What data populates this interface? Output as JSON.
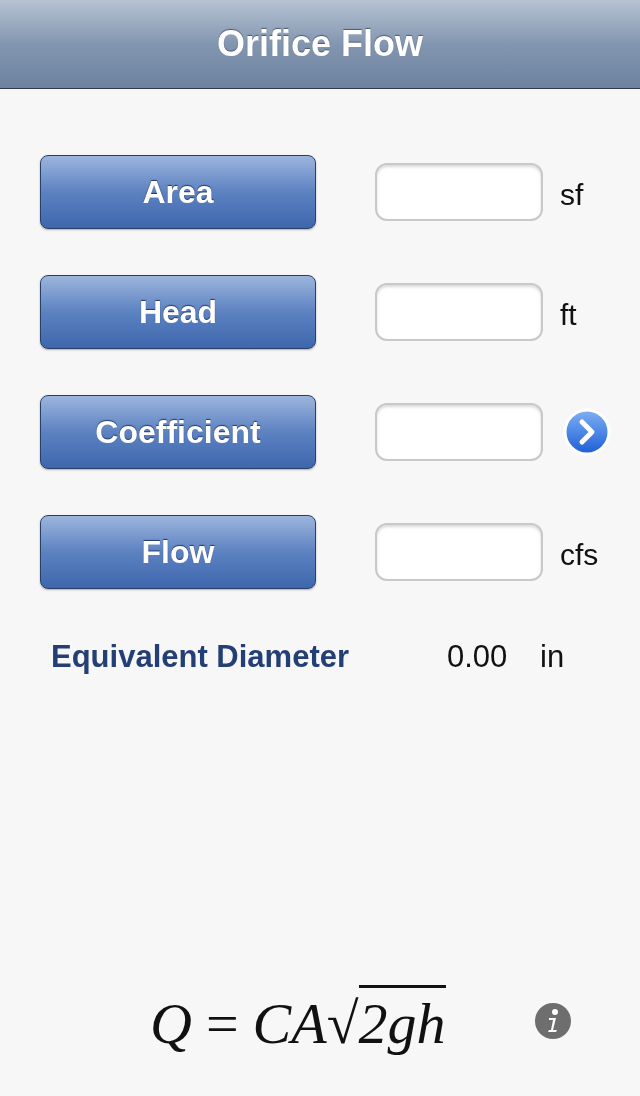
{
  "title": "Orifice Flow",
  "rows": [
    {
      "button": "Area",
      "kind": "unit",
      "unit": "sf"
    },
    {
      "button": "Head",
      "kind": "unit",
      "unit": "ft"
    },
    {
      "button": "Coefficient",
      "kind": "detail"
    },
    {
      "button": "Flow",
      "kind": "unit",
      "unit": "cfs"
    }
  ],
  "result": {
    "label": "Equivalent Diameter",
    "value": "0.00",
    "unit": "in"
  },
  "formula": {
    "lhs": "Q",
    "equals": "=",
    "factors": "CA",
    "radical": "√",
    "radicand": "2gh"
  }
}
